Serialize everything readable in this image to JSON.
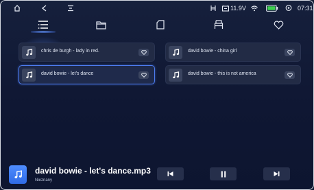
{
  "status_bar": {
    "voltage": "11.9V",
    "time": "07:31",
    "icons": [
      "home-icon",
      "back-icon",
      "menu-icon",
      "seat-icon",
      "battery-voltage-icon",
      "wifi-icon",
      "battery-icon",
      "location-icon"
    ]
  },
  "tabs": [
    {
      "name": "playlist",
      "icon": "list-icon",
      "active": true
    },
    {
      "name": "folders",
      "icon": "folder-icon",
      "active": false
    },
    {
      "name": "sd-card",
      "icon": "sd-card-icon",
      "active": false
    },
    {
      "name": "usb",
      "icon": "usb-icon",
      "active": false
    },
    {
      "name": "favorites",
      "icon": "heart-icon",
      "active": false
    }
  ],
  "songs": [
    {
      "title": "chris de burgh - lady in red.",
      "selected": false
    },
    {
      "title": "david bowie - china girl",
      "selected": false
    },
    {
      "title": "david bowie - let's dance",
      "selected": true
    },
    {
      "title": "david bowie - this is not america",
      "selected": false
    }
  ],
  "now_playing": {
    "title": "david bowie - let's dance.mp3",
    "artist": "Nieznany"
  },
  "colors": {
    "background": "#111a33",
    "card": "#222b45",
    "accent": "#4d7cf0",
    "battery": "#3ccf4e"
  }
}
